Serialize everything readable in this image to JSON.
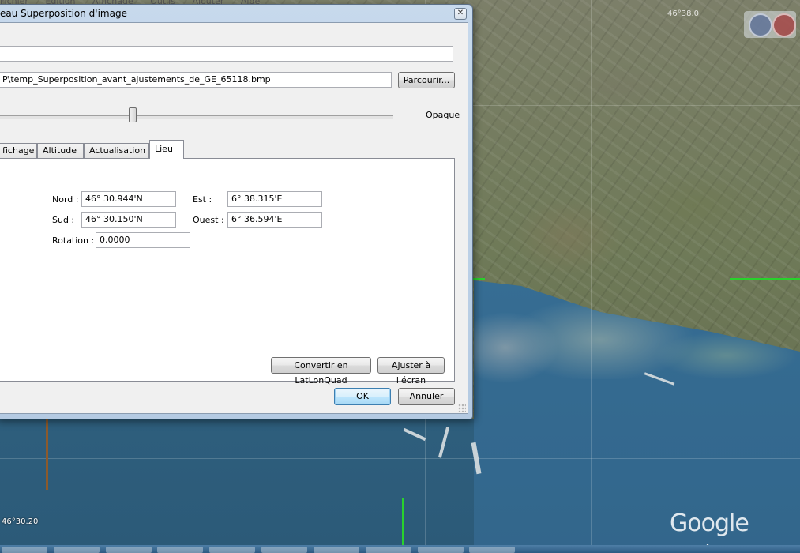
{
  "app_menu": [
    "Fichier",
    "Édition",
    "Affichage",
    "Outils",
    "Ajouter",
    "Aide"
  ],
  "map": {
    "top_coordinate": "46°38.0'",
    "lat_label": "46°30.20",
    "brand_main": "Google",
    "brand_suffix": "earth"
  },
  "dialog": {
    "title": "eau Superposition d'image",
    "close_glyph": "✕",
    "name_value": "",
    "link_value": "P\\temp_Superposition_avant_ajustements_de_GE_65118.bmp",
    "browse_label": "Parcourir...",
    "transparency": {
      "end_label": "Opaque",
      "value_fraction": 0.34
    },
    "tabs": [
      "fichage",
      "Altitude",
      "Actualisation",
      "Lieu"
    ],
    "active_tab": "Lieu",
    "lieu": {
      "north_label": "Nord :",
      "north_value": "46° 30.944'N",
      "east_label": "Est :",
      "east_value": "6° 38.315'E",
      "south_label": "Sud :",
      "south_value": "46° 30.150'N",
      "west_label": "Ouest :",
      "west_value": "6° 36.594'E",
      "rotation_label": "Rotation :",
      "rotation_value": "0.0000",
      "convert_label": "Convertir en LatLonQuad",
      "fit_label": "Ajuster à l'écran"
    },
    "ok_label": "OK",
    "cancel_label": "Annuler"
  },
  "colors": {
    "overlay_boundary": "#29d12c",
    "dialog_frame": "#b4cae2"
  }
}
